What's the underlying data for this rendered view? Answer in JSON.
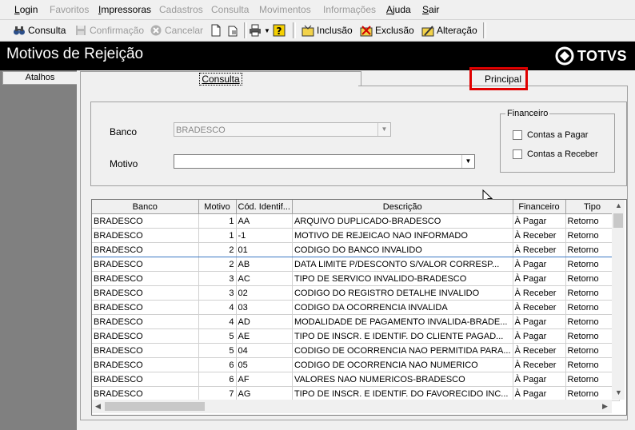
{
  "menu": {
    "items": [
      {
        "label": "Login",
        "enabled": true,
        "mnemonic": "L"
      },
      {
        "label": "Favoritos",
        "enabled": false
      },
      {
        "label": "Impressoras",
        "enabled": true,
        "mnemonic": "I"
      },
      {
        "label": "Cadastros",
        "enabled": false
      },
      {
        "label": "Consulta",
        "enabled": false
      },
      {
        "label": "Movimentos",
        "enabled": false
      },
      {
        "label": "Informações",
        "enabled": false
      },
      {
        "label": "Ajuda",
        "enabled": true,
        "mnemonic": "A"
      },
      {
        "label": "Sair",
        "enabled": true,
        "mnemonic": "S"
      }
    ]
  },
  "toolbar": {
    "consulta": "Consulta",
    "confirmacao": "Confirmação",
    "cancelar": "Cancelar",
    "inclusao": "Inclusão",
    "exclusao": "Exclusão",
    "alteracao": "Alteração"
  },
  "header": {
    "title": "Motivos de Rejeição",
    "logo": "TOTVS"
  },
  "sidebar": {
    "atalhos": "Atalhos"
  },
  "tabs": {
    "consulta": "Consulta",
    "principal": "Principal"
  },
  "filters": {
    "banco_label": "Banco",
    "banco_value": "BRADESCO",
    "motivo_label": "Motivo",
    "motivo_value": "",
    "financeiro_title": "Financeiro",
    "contas_pagar": "Contas a Pagar",
    "contas_receber": "Contas a Receber"
  },
  "grid": {
    "columns": [
      "Banco",
      "Motivo",
      "Cód. Identif...",
      "Descrição",
      "Financeiro",
      "Tipo"
    ],
    "selected_row": 2,
    "rows": [
      [
        "BRADESCO",
        "1",
        "AA",
        "ARQUIVO DUPLICADO-BRADESCO",
        "À Pagar",
        "Retorno"
      ],
      [
        "BRADESCO",
        "1",
        "-1",
        "MOTIVO DE REJEICAO NAO INFORMADO",
        "À Receber",
        "Retorno"
      ],
      [
        "BRADESCO",
        "2",
        "01",
        "CODIGO DO BANCO INVALIDO",
        "À Receber",
        "Retorno"
      ],
      [
        "BRADESCO",
        "2",
        "AB",
        "DATA LIMITE P/DESCONTO S/VALOR CORRESP...",
        "À Pagar",
        "Retorno"
      ],
      [
        "BRADESCO",
        "3",
        "AC",
        "TIPO DE SERVICO INVALIDO-BRADESCO",
        "À Pagar",
        "Retorno"
      ],
      [
        "BRADESCO",
        "3",
        "02",
        "CODIGO DO REGISTRO DETALHE INVALIDO",
        "À Receber",
        "Retorno"
      ],
      [
        "BRADESCO",
        "4",
        "03",
        "CODIGO DA OCORRENCIA INVALIDA",
        "À Receber",
        "Retorno"
      ],
      [
        "BRADESCO",
        "4",
        "AD",
        "MODALIDADE DE PAGAMENTO INVALIDA-BRADE...",
        "À Pagar",
        "Retorno"
      ],
      [
        "BRADESCO",
        "5",
        "AE",
        "TIPO DE INSCR. E IDENTIF. DO CLIENTE PAGAD...",
        "À Pagar",
        "Retorno"
      ],
      [
        "BRADESCO",
        "5",
        "04",
        "CODIGO DE OCORRENCIA NAO PERMITIDA PARA...",
        "À Receber",
        "Retorno"
      ],
      [
        "BRADESCO",
        "6",
        "05",
        "CODIGO DE OCORRENCIA NAO NUMERICO",
        "À Receber",
        "Retorno"
      ],
      [
        "BRADESCO",
        "6",
        "AF",
        "VALORES NAO NUMERICOS-BRADESCO",
        "À Pagar",
        "Retorno"
      ],
      [
        "BRADESCO",
        "7",
        "AG",
        "TIPO DE INSCR. E IDENTIF. DO FAVORECIDO INC...",
        "À Pagar",
        "Retorno"
      ]
    ]
  },
  "colors": {
    "highlight": "#e00000",
    "title_bg": "#000000",
    "sidebar_bg": "#808080"
  }
}
